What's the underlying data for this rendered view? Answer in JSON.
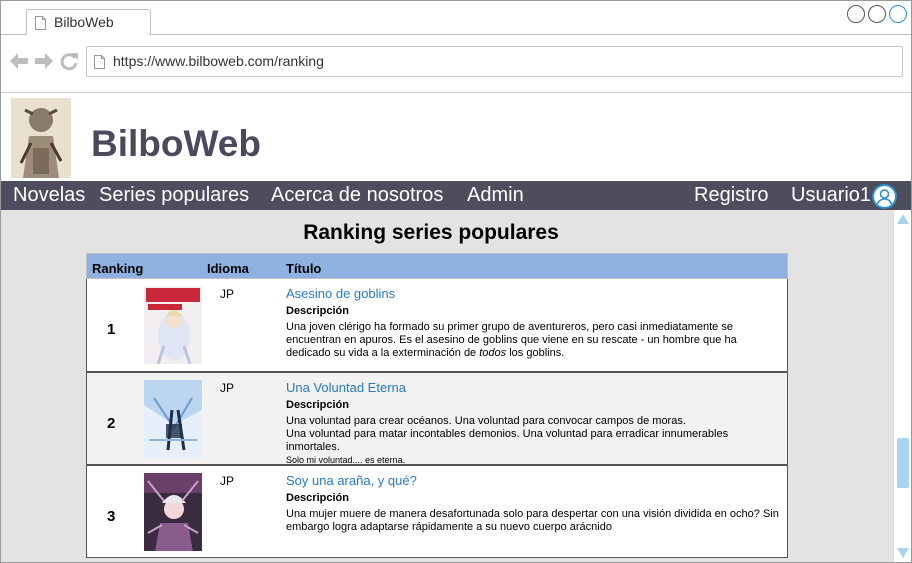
{
  "browser": {
    "tab_title": "BilboWeb",
    "url": "https://www.bilboweb.com/ranking"
  },
  "site": {
    "brand": "BilboWeb",
    "menu": {
      "novelas": "Novelas",
      "series": "Series populares",
      "about": "Acerca de nosotros",
      "admin": "Admin",
      "registro": "Registro",
      "usuario": "Usuario1"
    }
  },
  "page": {
    "title": "Ranking series populares",
    "columns": {
      "ranking": "Ranking",
      "idioma": "Idioma",
      "titulo": "Título"
    },
    "rows": [
      {
        "rank": "1",
        "lang": "JP",
        "title": "Asesino de goblins",
        "desc_label": "Descripción",
        "desc": "Una joven clérigo ha formado su primer grupo de aventureros, pero casi inmediatamente se encuentran en apuros. Es el asesino de goblins que viene en su rescate - un hombre que ha dedicado su vida a la exterminación de",
        "desc_italic": "todos",
        "desc_tail": "los goblins."
      },
      {
        "rank": "2",
        "lang": "JP",
        "title": "Una Voluntad Eterna",
        "desc_label": "Descripción",
        "desc_line1": "Una voluntad para crear océanos. Una voluntad para convocar campos de moras.",
        "desc_line2": "Una voluntad para matar incontables demonios. Una voluntad para erradicar innumerables inmortales.",
        "desc_line3": "Solo mi voluntad.... es eterna."
      },
      {
        "rank": "3",
        "lang": "JP",
        "title": "Soy una araña, y qué?",
        "desc_label": "Descripción",
        "desc": "Una mujer muere de manera desafortunada solo para despertar con una visión dividida en ocho? Sin embargo logra adaptarse rápidamente a su nuevo cuerpo arácnido"
      }
    ]
  },
  "colors": {
    "menu_bg": "#4d4d5e",
    "table_header": "#8eb1e1",
    "link": "#2a79c2",
    "accent": "#2b8fd0"
  }
}
